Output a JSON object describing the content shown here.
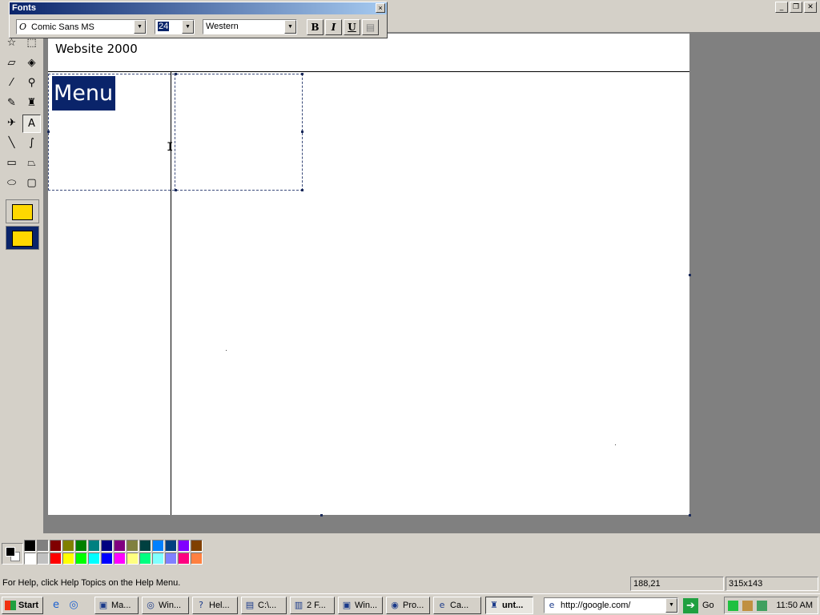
{
  "window": {
    "min_glyph": "_",
    "max_glyph": "❐",
    "close_glyph": "✕"
  },
  "fonts_toolbar": {
    "title": "Fonts",
    "close_glyph": "×",
    "font_icon": "O",
    "font_name": "Comic Sans MS",
    "font_size": "24",
    "script": "Western",
    "bold_label": "B",
    "italic_label": "I",
    "underline_label": "U",
    "dropdown_glyph": "▼"
  },
  "canvas": {
    "site_title": "Website 2000",
    "selected_text": "Menu",
    "cursor_glyph": "I"
  },
  "tools": [
    {
      "name": "free-form-select-tool",
      "glyph": "☆"
    },
    {
      "name": "select-tool",
      "glyph": "⬚"
    },
    {
      "name": "eraser-tool",
      "glyph": "▱"
    },
    {
      "name": "fill-tool",
      "glyph": "◈"
    },
    {
      "name": "pick-color-tool",
      "glyph": "⁄"
    },
    {
      "name": "magnifier-tool",
      "glyph": "⚲"
    },
    {
      "name": "pencil-tool",
      "glyph": "✎"
    },
    {
      "name": "brush-tool",
      "glyph": "♜"
    },
    {
      "name": "airbrush-tool",
      "glyph": "✈"
    },
    {
      "name": "text-tool",
      "glyph": "A"
    },
    {
      "name": "line-tool",
      "glyph": "╲"
    },
    {
      "name": "curve-tool",
      "glyph": "∫"
    },
    {
      "name": "rectangle-tool",
      "glyph": "▭"
    },
    {
      "name": "polygon-tool",
      "glyph": "⏢"
    },
    {
      "name": "ellipse-tool",
      "glyph": "⬭"
    },
    {
      "name": "rounded-rectangle-tool",
      "glyph": "▢"
    }
  ],
  "palette": {
    "foreground": "#000000",
    "background": "#ffffff",
    "colors_top": [
      "#000000",
      "#808080",
      "#800000",
      "#808000",
      "#008000",
      "#008080",
      "#000080",
      "#800080",
      "#808040",
      "#004040",
      "#0080ff",
      "#004080",
      "#8000ff",
      "#804000"
    ],
    "colors_bottom": [
      "#ffffff",
      "#c0c0c0",
      "#ff0000",
      "#ffff00",
      "#00ff00",
      "#00ffff",
      "#0000ff",
      "#ff00ff",
      "#ffff80",
      "#00ff80",
      "#80ffff",
      "#8080ff",
      "#ff0080",
      "#ff8040"
    ]
  },
  "status": {
    "help": "For Help, click Help Topics on the Help Menu.",
    "coords": "188,21",
    "size": "315x143"
  },
  "taskbar": {
    "start": "Start",
    "quick_launch": [
      {
        "name": "ie-quicklaunch-icon",
        "glyph": "e"
      },
      {
        "name": "browser-quicklaunch-icon",
        "glyph": "◎"
      }
    ],
    "tasks": [
      {
        "label": "Ma...",
        "icon": "▣"
      },
      {
        "label": "Win...",
        "icon": "◎"
      },
      {
        "label": "Hel...",
        "icon": "?"
      },
      {
        "label": "C:\\...",
        "icon": "▤"
      },
      {
        "label": "2 F...",
        "icon": "▥"
      },
      {
        "label": "Win...",
        "icon": "▣"
      },
      {
        "label": "Pro...",
        "icon": "◉"
      },
      {
        "label": "Ca...",
        "icon": "e"
      },
      {
        "label": "unt...",
        "icon": "♜"
      }
    ],
    "address": "http://google.com/",
    "go": "Go",
    "go_glyph": "➔",
    "clock": "11:50 AM"
  }
}
